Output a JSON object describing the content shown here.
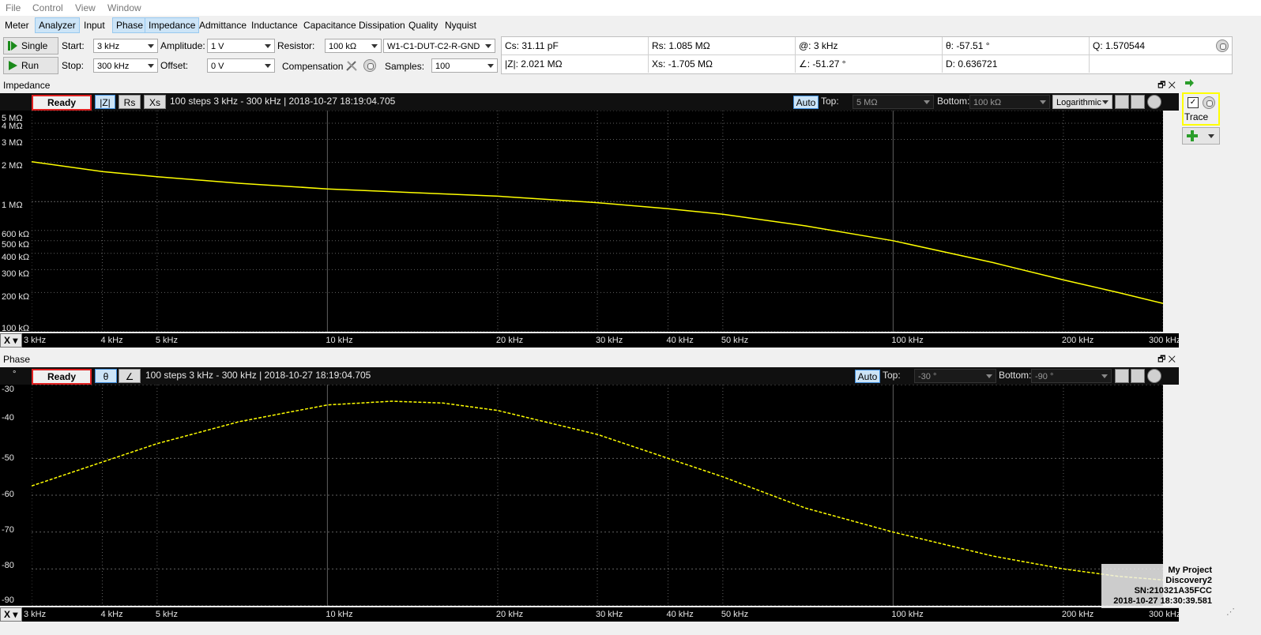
{
  "menu": [
    "File",
    "Control",
    "View",
    "Window"
  ],
  "tabs": [
    "Meter",
    "Analyzer",
    "Input",
    "Phase",
    "Impedance",
    "Admittance",
    "Inductance",
    "Capacitance",
    "Dissipation",
    "Quality",
    "Nyquist"
  ],
  "controls": {
    "single_label": "Single",
    "run_label": "Run",
    "start_label": "Start:",
    "start_value": "3 kHz",
    "stop_label": "Stop:",
    "stop_value": "300 kHz",
    "amplitude_label": "Amplitude:",
    "amplitude_value": "1 V",
    "offset_label": "Offset:",
    "offset_value": "0 V",
    "resistor_label": "Resistor:",
    "resistor_value": "100 kΩ",
    "wiring_value": "W1-C1-DUT-C2-R-GND",
    "compensation_label": "Compensation",
    "samples_label": "Samples:",
    "samples_value": "100"
  },
  "measurements": {
    "cs": "Cs: 31.11 pF",
    "rs": "Rs: 1.085 MΩ",
    "freq": "@: 3 kHz",
    "theta": "θ: -57.51 °",
    "q": "Q: 1.570544",
    "z": "|Z|: 2.021 MΩ",
    "xs": "Xs: -1.705 MΩ",
    "angle": "∠: -51.27 °",
    "d": "D: 0.636721"
  },
  "impedance_panel": {
    "title": "Impedance",
    "status": "Ready",
    "btn_z": "|Z|",
    "btn_rs": "Rs",
    "btn_xs": "Xs",
    "info": "100 steps 3 kHz - 300 kHz | 2018-10-27 18:19:04.705",
    "auto": "Auto",
    "top_label": "Top:",
    "top_value": "5 MΩ",
    "bottom_label": "Bottom:",
    "bottom_value": "100 kΩ",
    "scale_value": "Logarithmic",
    "y_ticks": [
      "5 MΩ",
      "4 MΩ",
      "3 MΩ",
      "2 MΩ",
      "1 MΩ",
      "600 kΩ",
      "500 kΩ",
      "400 kΩ",
      "300 kΩ",
      "200 kΩ",
      "100 kΩ"
    ]
  },
  "phase_panel": {
    "title": "Phase",
    "status": "Ready",
    "btn_theta": "θ",
    "btn_angle": "∠",
    "info": "100 steps 3 kHz - 300 kHz | 2018-10-27 18:19:04.705",
    "auto": "Auto",
    "top_label": "Top:",
    "top_value": "-30 °",
    "bottom_label": "Bottom:",
    "bottom_value": "-90 °",
    "y_unit": "°",
    "y_ticks": [
      "-30",
      "-40",
      "-50",
      "-60",
      "-70",
      "-80",
      "-90"
    ]
  },
  "x_axis": {
    "btn": "X",
    "ticks": [
      "3 kHz",
      "4 kHz",
      "5 kHz",
      "10 kHz",
      "20 kHz",
      "30 kHz",
      "40 kHz",
      "50 kHz",
      "100 kHz",
      "200 kHz",
      "300 kHz"
    ]
  },
  "side": {
    "trace_label": "Trace"
  },
  "overlay": {
    "project": "My Project",
    "device": "Discovery2",
    "serial": "SN:210321A35FCC",
    "timestamp": "2018-10-27 18:30:39.581"
  },
  "colors": {
    "trace": "#ffff00",
    "plot_bg": "#000000",
    "grid": "#606060",
    "tab_active": "#cce4f7"
  },
  "chart_data": [
    {
      "type": "line",
      "x_scale": "log",
      "y_scale": "log",
      "xlim_hz": [
        3000,
        300000
      ],
      "ylim_ohm": [
        100000,
        5000000
      ],
      "series": [
        {
          "x_hz": [
            3000,
            4000,
            5000,
            7000,
            10000,
            15000,
            20000,
            30000,
            40000,
            50000,
            70000,
            100000,
            150000,
            200000,
            250000,
            300000
          ],
          "y_ohm": [
            2021000,
            1700000,
            1550000,
            1380000,
            1250000,
            1160000,
            1100000,
            980000,
            880000,
            800000,
            650000,
            500000,
            340000,
            250000,
            200000,
            165000
          ]
        }
      ]
    },
    {
      "type": "line",
      "x_scale": "log",
      "xlim_hz": [
        3000,
        300000
      ],
      "ylim_deg": [
        -90,
        -30
      ],
      "series": [
        {
          "x_hz": [
            3000,
            4000,
            5000,
            7000,
            10000,
            13000,
            16000,
            20000,
            30000,
            40000,
            50000,
            70000,
            100000,
            150000,
            200000,
            250000,
            300000
          ],
          "y_deg": [
            -57.5,
            -51,
            -46,
            -40,
            -35.5,
            -34.5,
            -35,
            -37,
            -43.5,
            -50,
            -55,
            -63.5,
            -70,
            -76.5,
            -80,
            -82,
            -83
          ]
        }
      ]
    }
  ]
}
